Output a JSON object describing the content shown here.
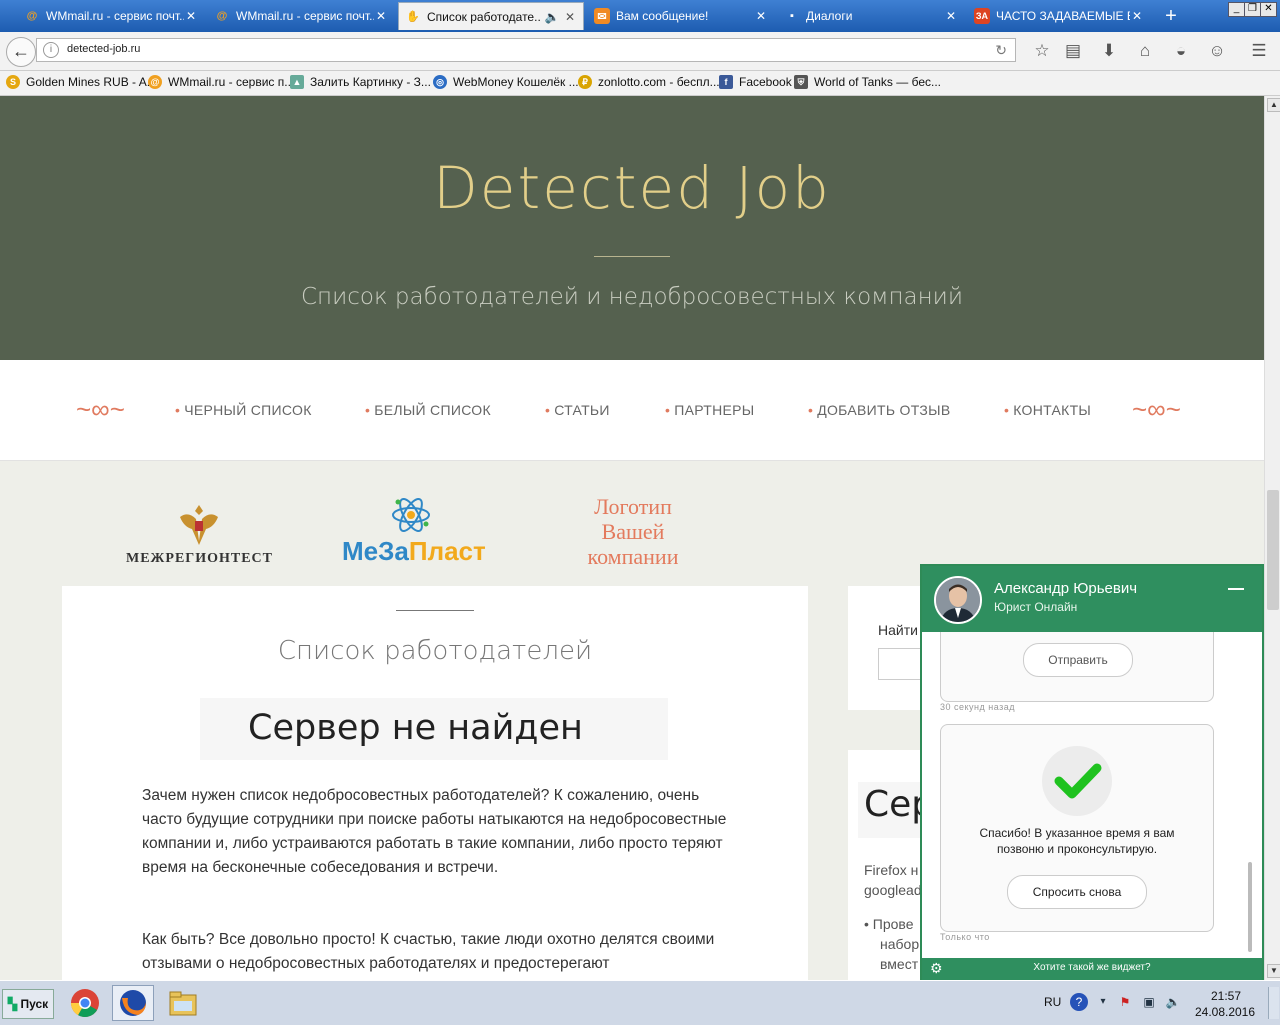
{
  "browser": {
    "tabs": [
      {
        "label": "WMmail.ru - сервис почт...",
        "icon": "at-icon"
      },
      {
        "label": "WMmail.ru - сервис почт...",
        "icon": "at-icon"
      },
      {
        "label": "Список работодате...",
        "icon": "hand-icon"
      },
      {
        "label": "Вам сообщение!",
        "icon": "envelope-icon"
      },
      {
        "label": "Диалоги",
        "icon": "chat-bubble-icon"
      },
      {
        "label": "ЧАСТО ЗАДАВАЕМЫЕ В...",
        "icon": "za-logo-icon"
      }
    ],
    "new_tab": "+",
    "url": "detected-job.ru",
    "bookmarks": [
      {
        "label": "Golden Mines RUB - A...",
        "icon": "s-coin-icon"
      },
      {
        "label": "WMmail.ru - сервис п...",
        "icon": "wmmail-icon"
      },
      {
        "label": "Залить Картинку - З...",
        "icon": "image-icon"
      },
      {
        "label": "WebMoney Кошелёк ...",
        "icon": "webmoney-icon"
      },
      {
        "label": "zonlotto.com - беспл...",
        "icon": "zonlotto-icon"
      },
      {
        "label": "Facebook",
        "icon": "facebook-icon"
      },
      {
        "label": "World of Tanks — бес...",
        "icon": "wot-shield-icon"
      }
    ]
  },
  "site": {
    "title": "Detected Job",
    "subtitle": "Список работодателей и недобросовестных компаний",
    "menu": [
      "ЧЕРНЫЙ СПИСОК",
      "БЕЛЫЙ СПИСОК",
      "СТАТЬИ",
      "ПАРТНЕРЫ",
      "ДОБАВИТЬ ОТЗЫВ",
      "КОНТАКТЫ"
    ],
    "menu_bullet": "•",
    "partners": {
      "mrt": "МЕЖРЕГИОНТЕСТ",
      "mzp_a": "МеЗа",
      "mzp_b": "Пласт",
      "yours": "Логотип Вашей компании"
    },
    "content": {
      "title": "Список работодателей",
      "error": "Сервер не найден",
      "p1": "Зачем нужен список недобросовестных работодателей? К сожалению, очень часто будущие сотрудники при поиске работы натыкаются на недобросовестные компании и, либо устраиваются работать в такие компании, либо просто теряют время на бесконечные собеседования и встречи.",
      "p2": "Как быть? Все довольно просто! К счастью, такие люди охотно делятся своими отзывами о недобросовестных работодателях и предостерегают"
    },
    "sidebar": {
      "search_label": "Найти",
      "error_fragment": "Сер",
      "text1": "Firefox н",
      "text2": "googlead",
      "bullet1": "• Прове",
      "text3": "набор",
      "text4": "вмест"
    }
  },
  "chat": {
    "name": "Александр Юрьевич",
    "role": "Юрист Онлайн",
    "send_label": "Отправить",
    "ts1": "30 секунд назад",
    "thanks": "Спасибо! В указанное время я вам позвоню и проконсультирую.",
    "ask_again": "Спросить снова",
    "ts2": "Только что",
    "footer": "Хотите такой же виджет?",
    "accent": "#2f8f5f"
  },
  "taskbar": {
    "start": "Пуск",
    "lang": "RU",
    "time": "21:57",
    "date": "24.08.2016"
  }
}
